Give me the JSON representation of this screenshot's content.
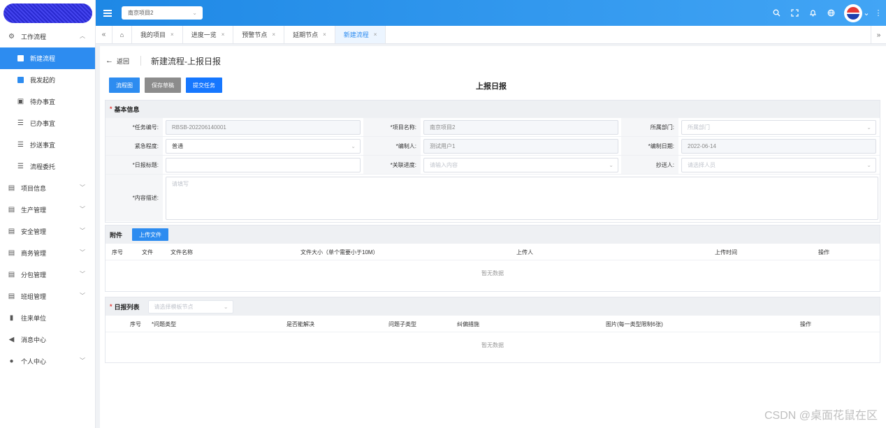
{
  "header": {
    "project": "南京项目2",
    "icons": [
      "search-icon",
      "fullscreen-icon",
      "bell-icon",
      "globe-icon",
      "more-icon"
    ]
  },
  "sidebar": {
    "items": [
      {
        "label": "工作流程",
        "icon": "workflow-icon",
        "expandable": true
      },
      {
        "label": "新建流程",
        "icon": "square-icon",
        "active": true
      },
      {
        "label": "我发起的",
        "icon": "edit-icon"
      },
      {
        "label": "待办事宜",
        "icon": "inbox-icon"
      },
      {
        "label": "已办事宜",
        "icon": "list-icon"
      },
      {
        "label": "抄送事宜",
        "icon": "list-icon"
      },
      {
        "label": "流程委托",
        "icon": "list-icon"
      },
      {
        "label": "项目信息",
        "icon": "doc-icon",
        "expandable": true
      },
      {
        "label": "生产管理",
        "icon": "doc-icon",
        "expandable": true
      },
      {
        "label": "安全管理",
        "icon": "doc-icon",
        "expandable": true
      },
      {
        "label": "商务管理",
        "icon": "doc-icon",
        "expandable": true
      },
      {
        "label": "分包管理",
        "icon": "doc-icon",
        "expandable": true
      },
      {
        "label": "班组管理",
        "icon": "doc-icon",
        "expandable": true
      },
      {
        "label": "往来单位",
        "icon": "building-icon"
      },
      {
        "label": "消息中心",
        "icon": "speaker-icon"
      },
      {
        "label": "个人中心",
        "icon": "user-icon",
        "expandable": true
      }
    ]
  },
  "tabs": [
    {
      "label": "我的项目"
    },
    {
      "label": "进度一览"
    },
    {
      "label": "预警节点"
    },
    {
      "label": "延期节点"
    },
    {
      "label": "新建流程",
      "active": true
    }
  ],
  "page": {
    "back": "返回",
    "title": "新建流程-上报日报",
    "form_title": "上报日报",
    "buttons": {
      "flowchart": "流程图",
      "save_draft": "保存草稿",
      "submit": "提交任务"
    }
  },
  "basic": {
    "heading": "基本信息",
    "task_no_label": "*任务编号:",
    "task_no": "RBSB-202206140001",
    "project_label": "*项目名称:",
    "project": "南京项目2",
    "dept_label": "所属部门:",
    "dept_placeholder": "所属部门",
    "urgency_label": "紧急程度:",
    "urgency": "普通",
    "editor_label": "*编制人:",
    "editor": "测试用户1",
    "date_label": "*编制日期:",
    "date": "2022-06-14",
    "title_label": "*日报标题:",
    "related_label": "*关联进度:",
    "related_placeholder": "请输入内容",
    "cc_label": "抄送人:",
    "cc_placeholder": "请选择人员",
    "desc_label": "*内容描述:",
    "desc_placeholder": "请填写"
  },
  "attachments": {
    "heading": "附件",
    "upload": "上传文件",
    "columns": [
      "序号",
      "文件",
      "文件名称",
      "文件大小（单个需要小于10M）",
      "上传人",
      "上传时间",
      "操作"
    ],
    "empty": "暂无数据"
  },
  "daily": {
    "heading": "日报列表",
    "select_placeholder": "请选择模板节点",
    "columns": [
      "序号",
      "*问题类型",
      "是否能解决",
      "问题子类型",
      "纠偏措施",
      "图片(每一类型限制6张)",
      "操作"
    ],
    "empty": "暂无数据"
  },
  "watermark": "CSDN @桌面花鼠在区"
}
